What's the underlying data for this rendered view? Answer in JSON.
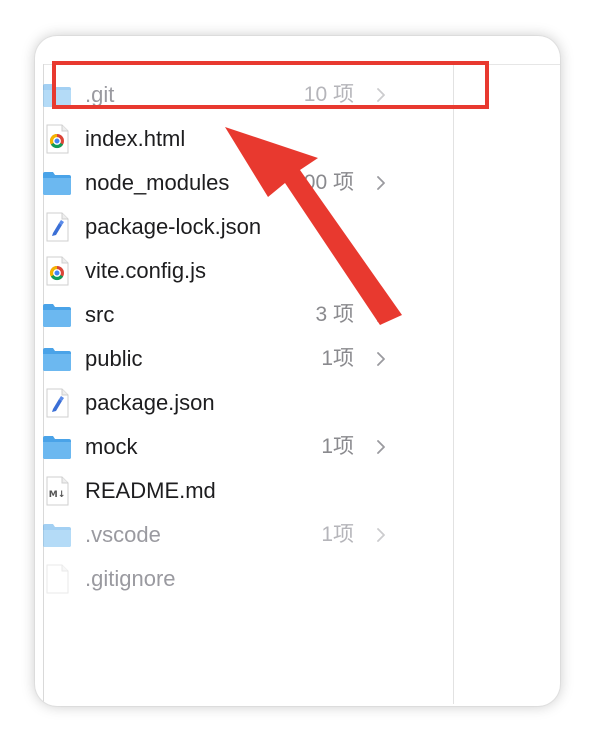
{
  "items": [
    {
      "name": ".git",
      "count": "10 项",
      "icon": "folder-icon",
      "chevron": true,
      "dim": true
    },
    {
      "name": "index.html",
      "count": "",
      "icon": "chrome-file-icon",
      "chevron": false,
      "dim": false
    },
    {
      "name": "node_modules",
      "count": "100 项",
      "icon": "folder-icon",
      "chevron": true,
      "dim": false
    },
    {
      "name": "package-lock.json",
      "count": "",
      "icon": "json-file-icon",
      "chevron": false,
      "dim": false
    },
    {
      "name": "vite.config.js",
      "count": "",
      "icon": "chrome-file-icon",
      "chevron": false,
      "dim": false
    },
    {
      "name": "src",
      "count": "3 项",
      "icon": "folder-icon",
      "chevron": true,
      "dim": false
    },
    {
      "name": "public",
      "count": "1项",
      "icon": "folder-icon",
      "chevron": true,
      "dim": false
    },
    {
      "name": "package.json",
      "count": "",
      "icon": "json-file-icon",
      "chevron": false,
      "dim": false
    },
    {
      "name": "mock",
      "count": "1项",
      "icon": "folder-icon",
      "chevron": true,
      "dim": false
    },
    {
      "name": "README.md",
      "count": "",
      "icon": "markdown-file-icon",
      "chevron": false,
      "dim": false
    },
    {
      "name": ".vscode",
      "count": "1项",
      "icon": "folder-icon",
      "chevron": true,
      "dim": true
    },
    {
      "name": ".gitignore",
      "count": "",
      "icon": "blank-file-icon",
      "chevron": false,
      "dim": true
    }
  ],
  "colors": {
    "folder": "#4aa3e8",
    "annotation": "#e8392f"
  },
  "markdown_icon_glyph": "M↓"
}
